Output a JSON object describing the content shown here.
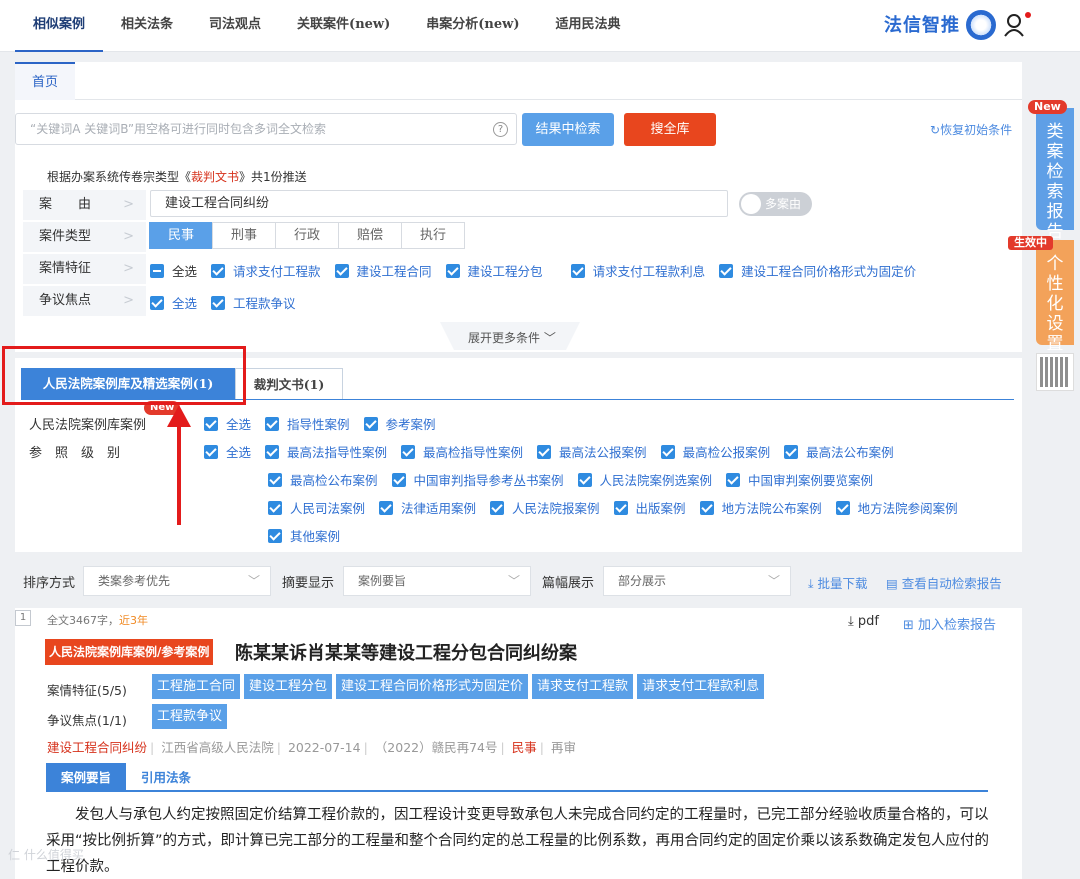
{
  "topnav": [
    "相似案例",
    "相关法条",
    "司法观点",
    "关联案件(new)",
    "串案分析(new)",
    "适用民法典"
  ],
  "brand": "法信智推",
  "home_tab": "首页",
  "search": {
    "placeholder": "“关键词A 关键词B”用空格可进行同时包含多词全文检索",
    "help": "?",
    "btn_result": "结果中检索",
    "btn_all": "搜全库",
    "restore": "恢复初始条件"
  },
  "notice": {
    "prefix": "根据办案系统传卷宗类型《",
    "doc": "裁判文书",
    "suffix": "》共1份推送"
  },
  "filters": {
    "case_cause_label": "案　　由",
    "case_cause_value": "建设工程合同纠纷",
    "toggle": "多案由",
    "case_type_label": "案件类型",
    "case_types": [
      "民事",
      "刑事",
      "行政",
      "赔偿",
      "执行"
    ],
    "features_label": "案情特征",
    "features": [
      "全选",
      "请求支付工程款",
      "建设工程合同",
      "建设工程分包",
      "请求支付工程款利息",
      "建设工程合同价格形式为固定价"
    ],
    "dispute_label": "争议焦点",
    "disputes": [
      "全选",
      "工程款争议"
    ],
    "expand": "展开更多条件 ﹀"
  },
  "lib": {
    "tab_on": "人民法院案例库及精选案例(1)",
    "tab_off": "裁判文书(1)",
    "new_badge": "New",
    "row1_label": "人民法院案例库案例",
    "row1_opts": [
      "全选",
      "指导性案例",
      "参考案例"
    ],
    "row2_label": "参　照　级　别",
    "row2_opts": [
      "全选",
      "最高法指导性案例",
      "最高检指导性案例",
      "最高法公报案例",
      "最高检公报案例",
      "最高法公布案例"
    ],
    "row3_opts": [
      "最高检公布案例",
      "中国审判指导参考丛书案例",
      "人民法院案例选案例",
      "中国审判案例要览案例"
    ],
    "row4_opts": [
      "人民司法案例",
      "法律适用案例",
      "人民法院报案例",
      "出版案例",
      "地方法院公布案例",
      "地方法院参阅案例"
    ],
    "row5_opts": [
      "其他案例"
    ]
  },
  "sort": {
    "label1": "排序方式",
    "val1": "类案参考优先",
    "label2": "摘要显示",
    "val2": "案例要旨",
    "label3": "篇幅展示",
    "val3": "部分展示",
    "batch": "批量下载",
    "view_report": "查看自动检索报告"
  },
  "result": {
    "index": "1",
    "words": "全文3467字，",
    "recent": "近3年",
    "pdf": "pdf",
    "add_report": "加入检索报告",
    "tag": "人民法院案例库案例/参考案例",
    "title": "陈某某诉肖某某等建设工程分包合同纠纷案",
    "features_label": "案情特征(5/5)",
    "features": [
      "工程施工合同",
      "建设工程分包",
      "建设工程合同价格形式为固定价",
      "请求支付工程款",
      "请求支付工程款利息"
    ],
    "dispute_label": "争议焦点(1/1)",
    "disputes": [
      "工程款争议"
    ],
    "cause": "建设工程合同纠纷",
    "court": "江西省高级人民法院",
    "date": "2022-07-14",
    "case_no": "（2022）赣民再74号",
    "domain": "民事",
    "procedure": "再审",
    "subtab_on": "案例要旨",
    "subtab_off": "引用法条",
    "summary": "发包人与承包人约定按照固定价结算工程价款的，因工程设计变更导致承包人未完成合同约定的工程量时，已完工部分经验收质量合格的，可以采用“按比例折算”的方式，即计算已完工部分的工程量和整个合同约定的总工程量的比例系数，再用合同约定的固定价乘以该系数确定发包人应付的工程价款。"
  },
  "side": {
    "report": "类案检索报告",
    "report_badge": "New",
    "settings": "个性化设置",
    "settings_badge": "生效中"
  },
  "watermark": "仁 什么值得买"
}
